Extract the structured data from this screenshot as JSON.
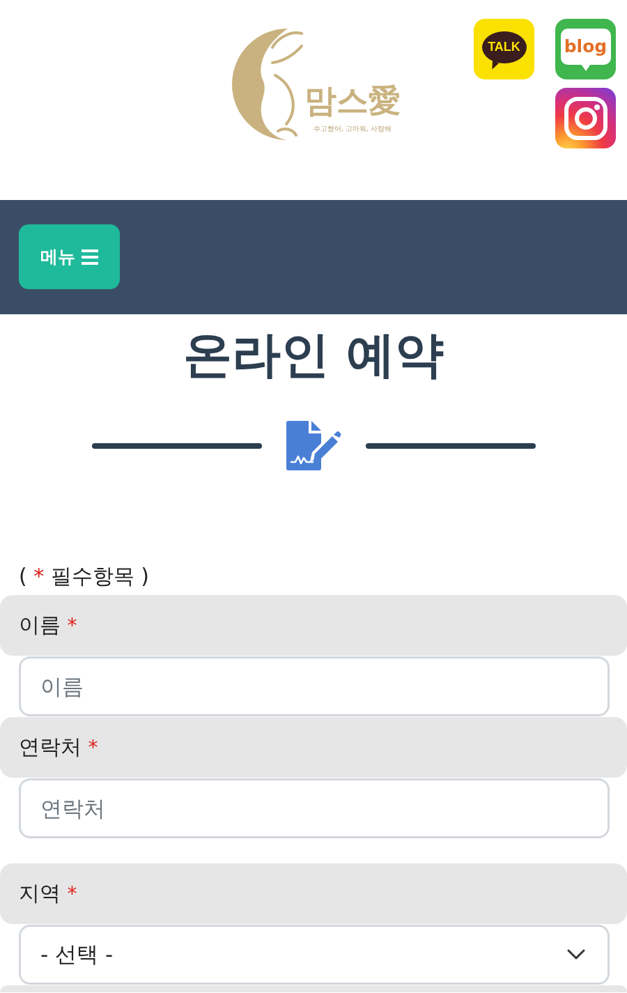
{
  "header": {
    "logo": {
      "name": "맘스愛",
      "tagline": "수고했어, 고마워, 사랑해"
    },
    "social_links": [
      {
        "kind": "talk",
        "label": "TALK"
      },
      {
        "kind": "blog",
        "label": "blog"
      },
      {
        "kind": "camera"
      }
    ]
  },
  "nav": {
    "menu_button": {
      "label": "메뉴"
    }
  },
  "title": "온라인 예약",
  "required_note": {
    "open": "(",
    "mark": "*",
    "text": "필수항목",
    "close": ")"
  },
  "fields": [
    {
      "kind": "input",
      "label": "이름",
      "required_mark": "*",
      "placeholder": "이름"
    },
    {
      "kind": "input",
      "label": "연락처",
      "required_mark": "*",
      "placeholder": "연락처"
    },
    {
      "kind": "select",
      "label": "지역",
      "required_mark": "*",
      "value": "- 선택 -"
    }
  ]
}
